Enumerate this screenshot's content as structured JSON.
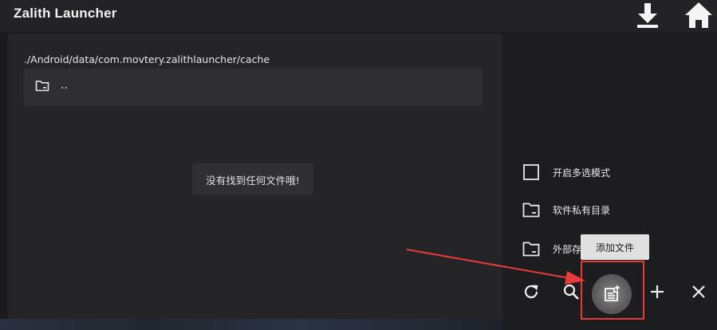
{
  "app": {
    "title": "Zalith Launcher"
  },
  "toolbar": {
    "download_icon": "download-icon",
    "home_icon": "home-icon"
  },
  "file_browser": {
    "path": "./Android/data/com.movtery.zalithlauncher/cache",
    "parent_entry": "..",
    "empty_message": "没有找到任何文件哦!"
  },
  "side_panel": {
    "multi_select": "开启多选模式",
    "private_dir": "软件私有目录",
    "external_dir": "外部存"
  },
  "tooltip": {
    "add_file": "添加文件"
  },
  "actions": {
    "refresh_icon": "refresh-icon",
    "search_icon": "search-icon",
    "add_file_icon": "add-file-icon",
    "add_icon": "plus-icon",
    "close_icon": "close-icon"
  },
  "colors": {
    "accent_red": "#e53b3b",
    "background": "#1b1b1d",
    "panel": "#252527"
  }
}
